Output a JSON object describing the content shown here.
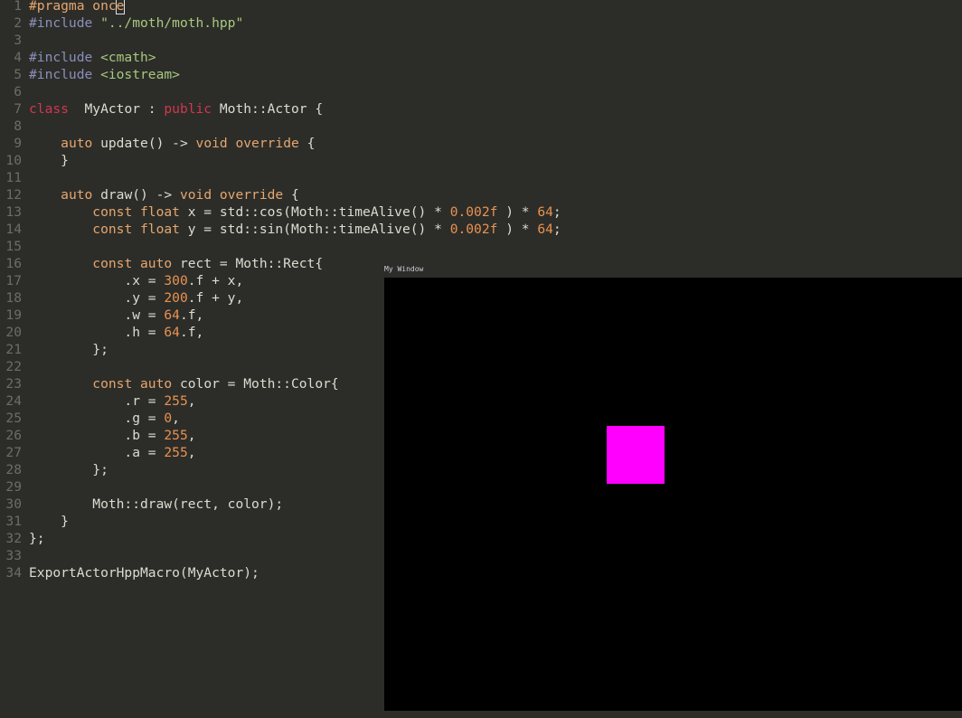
{
  "editor": {
    "lines": [
      [
        [
          "kw",
          "#pragma onc"
        ],
        [
          "kw cursor",
          "e"
        ]
      ],
      [
        [
          "pp",
          "#include "
        ],
        [
          "str",
          "\"../moth/moth.hpp\""
        ]
      ],
      [],
      [
        [
          "pp",
          "#include "
        ],
        [
          "str",
          "<cmath>"
        ]
      ],
      [
        [
          "pp",
          "#include "
        ],
        [
          "str",
          "<iostream>"
        ]
      ],
      [],
      [
        [
          "st",
          "class"
        ],
        [
          "",
          "  MyActor : "
        ],
        [
          "st",
          "public"
        ],
        [
          "",
          " Moth::Actor {"
        ]
      ],
      [],
      [
        [
          "",
          "    "
        ],
        [
          "kw",
          "auto"
        ],
        [
          "",
          " update() -> "
        ],
        [
          "kw",
          "void override"
        ],
        [
          "",
          " {"
        ]
      ],
      [
        [
          "",
          "    }"
        ]
      ],
      [],
      [
        [
          "",
          "    "
        ],
        [
          "kw",
          "auto"
        ],
        [
          "",
          " draw() -> "
        ],
        [
          "kw",
          "void override"
        ],
        [
          "",
          " {"
        ]
      ],
      [
        [
          "",
          "        "
        ],
        [
          "kw",
          "const float"
        ],
        [
          "",
          " x = std::cos(Moth::timeAlive() * "
        ],
        [
          "num",
          "0.002f"
        ],
        [
          "",
          " ) * "
        ],
        [
          "num",
          "64"
        ],
        [
          "",
          ";"
        ]
      ],
      [
        [
          "",
          "        "
        ],
        [
          "kw",
          "const float"
        ],
        [
          "",
          " y = std::sin(Moth::timeAlive() * "
        ],
        [
          "num",
          "0.002f"
        ],
        [
          "",
          " ) * "
        ],
        [
          "num",
          "64"
        ],
        [
          "",
          ";"
        ]
      ],
      [],
      [
        [
          "",
          "        "
        ],
        [
          "kw",
          "const auto"
        ],
        [
          "",
          " rect = Moth::Rect{"
        ]
      ],
      [
        [
          "",
          "            .x = "
        ],
        [
          "num",
          "300"
        ],
        [
          "",
          ".f + x,"
        ]
      ],
      [
        [
          "",
          "            .y = "
        ],
        [
          "num",
          "200"
        ],
        [
          "",
          ".f + y,"
        ]
      ],
      [
        [
          "",
          "            .w = "
        ],
        [
          "num",
          "64"
        ],
        [
          "",
          ".f,"
        ]
      ],
      [
        [
          "",
          "            .h = "
        ],
        [
          "num",
          "64"
        ],
        [
          "",
          ".f,"
        ]
      ],
      [
        [
          "",
          "        };"
        ]
      ],
      [],
      [
        [
          "",
          "        "
        ],
        [
          "kw",
          "const auto"
        ],
        [
          "",
          " color = Moth::Color{"
        ]
      ],
      [
        [
          "",
          "            .r = "
        ],
        [
          "num",
          "255"
        ],
        [
          "",
          ","
        ]
      ],
      [
        [
          "",
          "            .g = "
        ],
        [
          "num",
          "0"
        ],
        [
          "",
          ","
        ]
      ],
      [
        [
          "",
          "            .b = "
        ],
        [
          "num",
          "255"
        ],
        [
          "",
          ","
        ]
      ],
      [
        [
          "",
          "            .a = "
        ],
        [
          "num",
          "255"
        ],
        [
          "",
          ","
        ]
      ],
      [
        [
          "",
          "        };"
        ]
      ],
      [],
      [
        [
          "",
          "        Moth::draw(rect, color);"
        ]
      ],
      [
        [
          "",
          "    }"
        ]
      ],
      [
        [
          "",
          "};"
        ]
      ],
      [],
      [
        [
          "",
          "ExportActorHppMacro(MyActor);"
        ]
      ]
    ]
  },
  "window": {
    "title": "My Window",
    "background": "#000000",
    "rect_color": "#ff00ff"
  }
}
